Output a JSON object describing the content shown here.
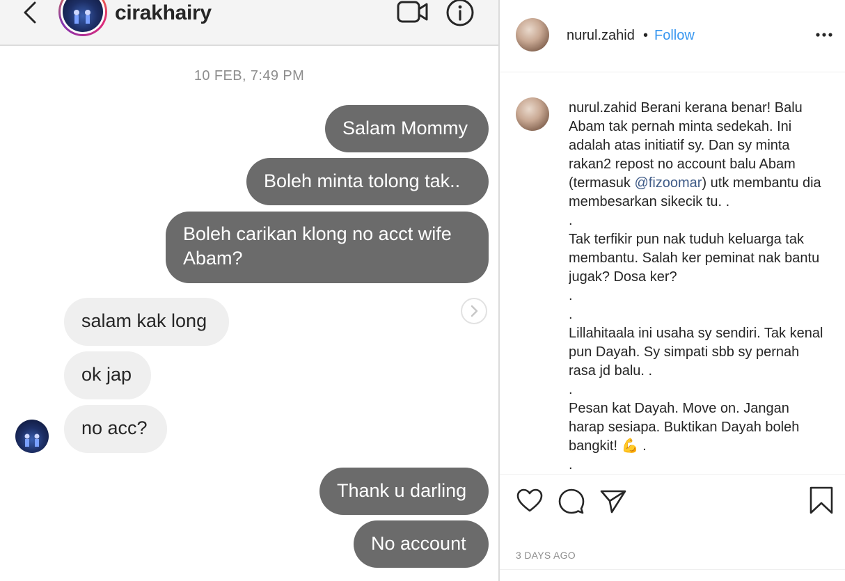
{
  "dm": {
    "username": "cirakhairy",
    "timestamp": "10 FEB, 7:49 PM",
    "messages": [
      {
        "direction": "outgoing",
        "text": "Salam Mommy"
      },
      {
        "direction": "outgoing",
        "text": "Boleh minta tolong tak.."
      },
      {
        "direction": "outgoing",
        "text": "Boleh carikan klong no acct wife Abam?"
      },
      {
        "direction": "incoming",
        "text": "salam kak long"
      },
      {
        "direction": "incoming",
        "text": "ok jap"
      },
      {
        "direction": "incoming",
        "text": "no acc?"
      },
      {
        "direction": "outgoing",
        "text": "Thank u darling"
      },
      {
        "direction": "outgoing",
        "text": "No account"
      }
    ],
    "icons": {
      "back": "chevron-left-icon",
      "video": "video-camera-icon",
      "info": "info-icon",
      "reply": "chevron-right-icon"
    }
  },
  "post": {
    "header": {
      "username": "nurul.zahid",
      "separator": "•",
      "follow_label": "Follow"
    },
    "caption": {
      "username": "nurul.zahid",
      "text_part1": "Berani kerana benar! Balu Abam tak pernah minta sedekah. Ini adalah atas initiatif sy. Dan sy minta rakan2 repost no account balu Abam (termasuk ",
      "mention": "@fizoomar",
      "text_part2": ") utk membantu dia membesarkan sikecik tu. .\n.\nTak terfikir pun nak tuduh keluarga tak membantu. Salah ker peminat nak bantu jugak? Dosa ker?\n.\n.\nLillahitaala ini usaha sy sendiri. Tak kenal pun Dayah. Sy simpati sbb sy pernah rasa jd balu. .\n.\nPesan kat Dayah. Move on. Jangan harap sesiapa. Buktikan Dayah boleh bangkit! ",
      "emoji": "💪",
      "text_part3": " .\n."
    },
    "time_label": "3 DAYS AGO",
    "icons": {
      "like": "heart-icon",
      "comment": "comment-icon",
      "share": "paper-plane-icon",
      "save": "bookmark-icon",
      "more": "more-horizontal-icon"
    },
    "colors": {
      "link": "#3897f0",
      "mention": "#3f5b87"
    }
  },
  "colors": {
    "outgoing_bubble": "#6b6b6b",
    "incoming_bubble": "#efefef",
    "header_bg": "#f4f4f4"
  }
}
